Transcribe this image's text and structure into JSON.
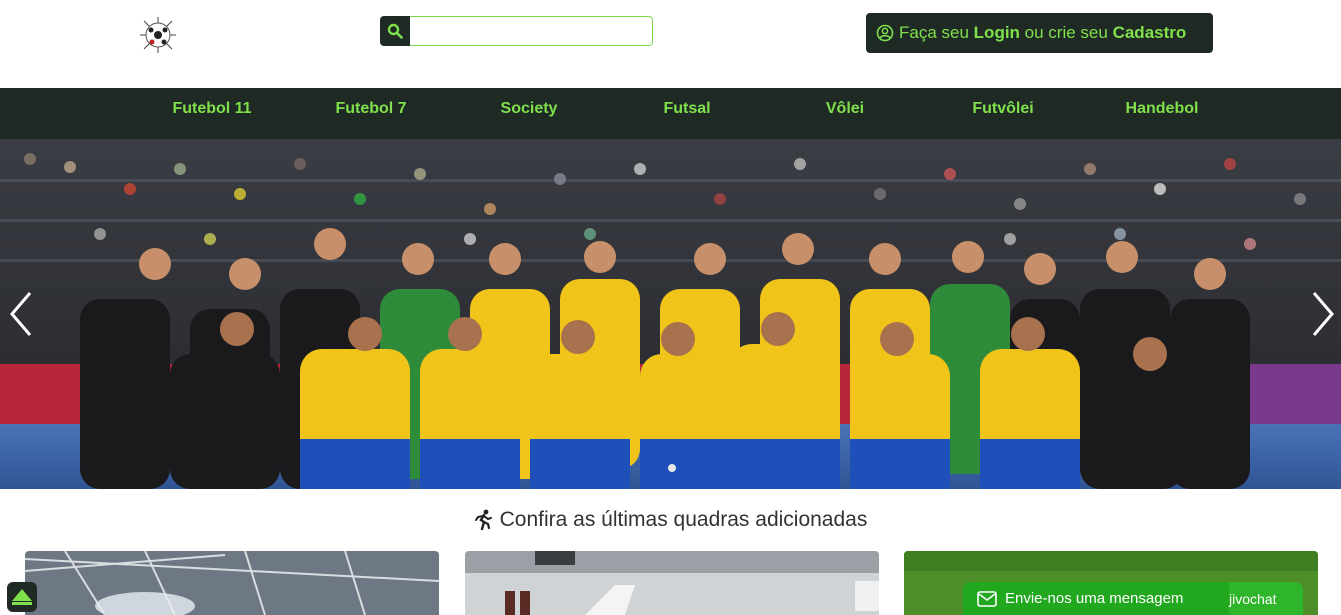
{
  "header": {
    "search_placeholder": "",
    "login": {
      "prefix": "Faça seu",
      "login_word": "Login",
      "middle": "ou crie seu",
      "register_word": "Cadastro"
    }
  },
  "nav": {
    "items": [
      "Futebol 11",
      "Futebol 7",
      "Society",
      "Futsal",
      "Vôlei",
      "Futvôlei",
      "Handebol"
    ]
  },
  "section": {
    "title": "Confira as últimas quadras adicionadas"
  },
  "chat": {
    "label": "Envie-nos uma mensagem",
    "brand": "jivochat"
  },
  "colors": {
    "dark": "#1f2a24",
    "accent_green": "#7fe04b",
    "chat_green": "#22a81f"
  }
}
